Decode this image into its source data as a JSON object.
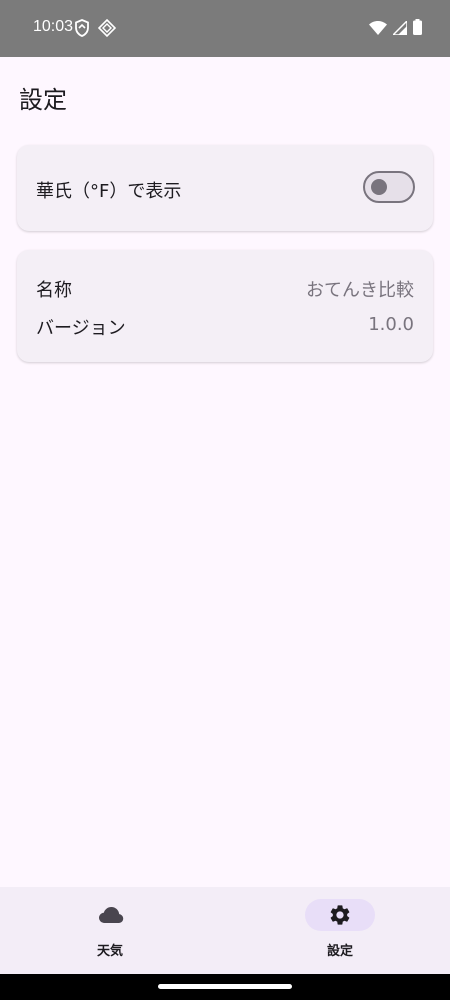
{
  "status_bar": {
    "time": "10:03"
  },
  "page": {
    "title": "設定"
  },
  "settings": {
    "fahrenheit_label": "華氏（°F）で表示",
    "fahrenheit_enabled": false
  },
  "info": {
    "name_label": "名称",
    "name_value": "おてんき比較",
    "version_label": "バージョン",
    "version_value": "1.0.0"
  },
  "bottom_nav": {
    "items": [
      {
        "label": "天気",
        "icon": "cloud-icon",
        "selected": false
      },
      {
        "label": "設定",
        "icon": "gear-icon",
        "selected": true
      }
    ]
  },
  "colors": {
    "background": "#fef7ff",
    "card": "#f4eff6",
    "nav_bar": "#f3edf7",
    "nav_indicator": "#e8def8",
    "secondary_text": "#79747e"
  }
}
